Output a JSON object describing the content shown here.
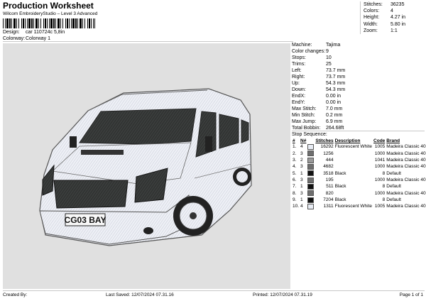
{
  "header": {
    "title": "Production Worksheet",
    "subtitle": "Wilcom EmbroideryStudio – Level 3 Advanced",
    "design_label": "Design:",
    "design_value": "car 110724c 5,8in",
    "colorway_label": "Colorway:",
    "colorway_value": "Colorway 1"
  },
  "summary": [
    {
      "k": "Stitches:",
      "v": "36235"
    },
    {
      "k": "Colors:",
      "v": "4"
    },
    {
      "k": "Height:",
      "v": "4.27 in"
    },
    {
      "k": "Width:",
      "v": "5.80 in"
    },
    {
      "k": "Zoom:",
      "v": "1:1"
    }
  ],
  "details": [
    {
      "k": "Machine:",
      "v": "Tajima"
    },
    {
      "k": "Color changes:",
      "v": "9"
    },
    {
      "k": "Stops:",
      "v": "10"
    },
    {
      "k": "Trims:",
      "v": "25"
    },
    {
      "k": "Left:",
      "v": "73.7 mm"
    },
    {
      "k": "Right:",
      "v": "73.7 mm"
    },
    {
      "k": "Up:",
      "v": "54.3 mm"
    },
    {
      "k": "Down:",
      "v": "54.3 mm"
    },
    {
      "k": "EndX:",
      "v": "0.00 in"
    },
    {
      "k": "EndY:",
      "v": "0.00 in"
    },
    {
      "k": "Max Stitch:",
      "v": "7.0 mm"
    },
    {
      "k": "Min Stitch:",
      "v": "0.2 mm"
    },
    {
      "k": "Max Jump:",
      "v": "6.9 mm"
    },
    {
      "k": "Total Bobbin:",
      "v": "264.68ft"
    }
  ],
  "sequence": {
    "label": "Stop Sequence:",
    "headers": [
      "#",
      "N#",
      "",
      "Stitches",
      "Description",
      "Code",
      "Brand"
    ],
    "rows": [
      {
        "n": "1.",
        "nn": "4",
        "color": "#e8ecf4",
        "st": "16292",
        "desc": "Fluorescent White",
        "code": "1005",
        "brand": "Madeira Classic 40"
      },
      {
        "n": "2.",
        "nn": "3",
        "color": "#6e6e6e",
        "st": "1256",
        "desc": "",
        "code": "1000",
        "brand": "Madeira Classic 40"
      },
      {
        "n": "3.",
        "nn": "2",
        "color": "#9a9a9a",
        "st": "444",
        "desc": "",
        "code": "1041",
        "brand": "Madeira Classic 40"
      },
      {
        "n": "4.",
        "nn": "3",
        "color": "#6e6e6e",
        "st": "4682",
        "desc": "",
        "code": "1000",
        "brand": "Madeira Classic 40"
      },
      {
        "n": "5.",
        "nn": "1",
        "color": "#111111",
        "st": "3518",
        "desc": "Black",
        "code": "8",
        "brand": "Default"
      },
      {
        "n": "6.",
        "nn": "3",
        "color": "#6e6e6e",
        "st": "195",
        "desc": "",
        "code": "1000",
        "brand": "Madeira Classic 40"
      },
      {
        "n": "7.",
        "nn": "1",
        "color": "#111111",
        "st": "511",
        "desc": "Black",
        "code": "8",
        "brand": "Default"
      },
      {
        "n": "8.",
        "nn": "3",
        "color": "#6e6e6e",
        "st": "820",
        "desc": "",
        "code": "1000",
        "brand": "Madeira Classic 40"
      },
      {
        "n": "9.",
        "nn": "1",
        "color": "#111111",
        "st": "7204",
        "desc": "Black",
        "code": "8",
        "brand": "Default"
      },
      {
        "n": "10.",
        "nn": "4",
        "color": "#e8ecf4",
        "st": "1311",
        "desc": "Fluorescent White",
        "code": "1005",
        "brand": "Madeira Classic 40"
      }
    ]
  },
  "design_image": {
    "plate": "CG03 BAY"
  },
  "footer": {
    "created_by": "Created By:",
    "last_saved": "Last Saved: 12/07/2024 07.31.16",
    "printed": "Printed: 12/07/2024 07.31.19",
    "page": "Page 1 of 1"
  }
}
